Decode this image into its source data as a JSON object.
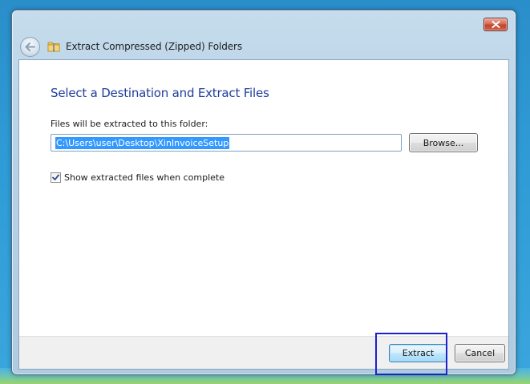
{
  "window": {
    "title": "Extract Compressed (Zipped) Folders"
  },
  "content": {
    "heading": "Select a Destination and Extract Files",
    "folder_label": "Files will be extracted to this folder:",
    "path_value": "C:\\Users\\user\\Desktop\\XinInvoiceSetup",
    "browse_label": "Browse...",
    "show_files_label": "Show extracted files when complete",
    "show_files_checked": true
  },
  "footer": {
    "extract_label": "Extract",
    "cancel_label": "Cancel"
  },
  "icons": {
    "close": "close-icon",
    "back": "back-arrow-icon",
    "folder": "zip-folder-icon",
    "check": "checkmark-icon"
  },
  "colors": {
    "heading": "#1e3f9a",
    "selection": "#3399ff",
    "focus_highlight": "#1a22c9"
  }
}
